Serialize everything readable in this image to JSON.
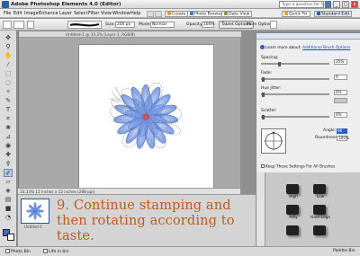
{
  "window": {
    "title": "Adobe Photoshop Elements 4.0 (Editor)",
    "help_placeholder": "Type a question for help",
    "min": "_",
    "max": "□",
    "close": "x"
  },
  "menu": {
    "items": [
      "File",
      "Edit",
      "Image",
      "Enhance",
      "Layer",
      "Select",
      "Filter",
      "View",
      "Window",
      "Help"
    ],
    "create_label": "Create",
    "photo_browser_label": "Photo Browser",
    "date_view_label": "Date View",
    "quick_fix_label": "Quick Fix",
    "standard_edit_label": "Standard Edit"
  },
  "options": {
    "size_label": "Size:",
    "size_value": "200 px",
    "mode_label": "Mode:",
    "mode_value": "Normal",
    "opacity_label": "Opacity:",
    "opacity_value": "100%",
    "tablet_label": "Tablet Options",
    "more_label": "More Options:"
  },
  "document": {
    "tab_text": "Untitled-1 @ 33.3% (Layer 1, RGB/8)",
    "status": "33.33%   12 inches x 12 inches (288 ppi)"
  },
  "bin": {
    "thumb_label": "Untitled-1",
    "caption": "9. Continue stamping and then rotating according to taste."
  },
  "bottom": {
    "photo_bin": "Photo Bin",
    "life_in_bin": "Life in bin",
    "palette_bin": "Palette Bin"
  },
  "brush_panel": {
    "learn_prefix": "Learn more about:",
    "learn_link": "Additional Brush Options",
    "spacing_label": "Spacing:",
    "spacing_value": "25%",
    "fade_label": "Fade:",
    "fade_value": "0",
    "hue_label": "Hue Jitter:",
    "hue_value": "0%",
    "scatter_label": "Scatter:",
    "scatter_value": "0%",
    "angle_label": "Angle:",
    "angle_value": "90",
    "roundness_label": "Roundness:",
    "roundness_value": "100%",
    "keep_label": "Keep These Settings For All Brushes"
  },
  "palette": {
    "items": [
      "High",
      "Low",
      "Hilly",
      "Hard Edge"
    ]
  },
  "colors": {
    "foreground": "#3c67c6",
    "caption": "#c25a1e",
    "accent": "#2c5ec4"
  },
  "icons": [
    "app-icon",
    "create-icon",
    "photo-browser-icon",
    "date-view-icon",
    "quick-fix-icon",
    "standard-edit-icon",
    "brush-preview-icon",
    "info-icon",
    "checkbox-icon",
    "angle-icon"
  ]
}
